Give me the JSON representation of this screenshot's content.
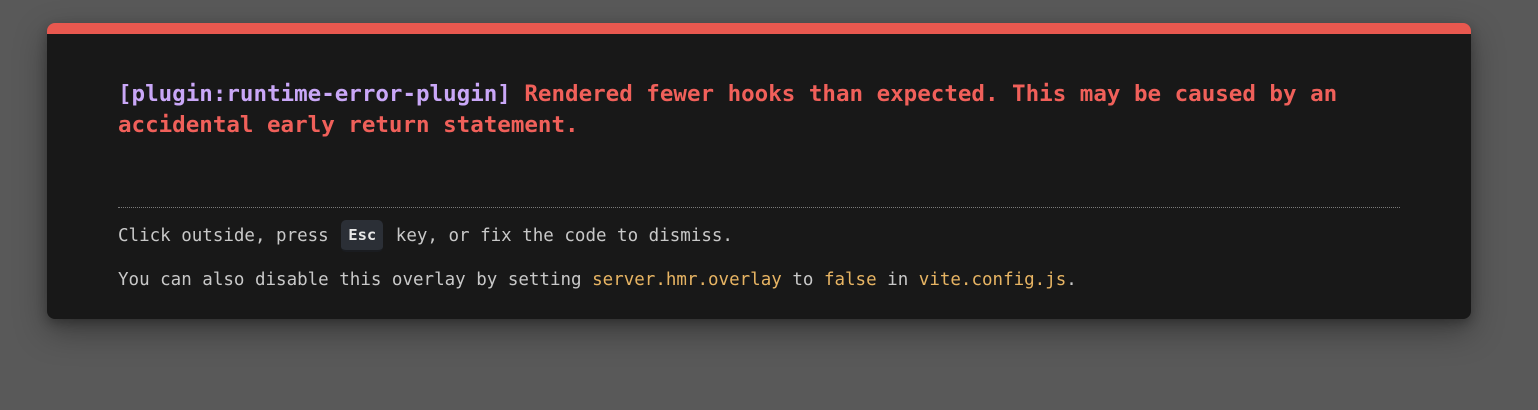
{
  "error": {
    "plugin": "[plugin:runtime-error-plugin]",
    "message": "Rendered fewer hooks than expected. This may be caused by an accidental early return statement."
  },
  "tip": {
    "line1_before": "Click outside, press ",
    "key": "Esc",
    "line1_after": " key, or fix the code to dismiss.",
    "line2_before": "You can also disable this overlay by setting ",
    "setting": "server.hmr.overlay",
    "line2_mid1": " to ",
    "value": "false",
    "line2_mid2": " in ",
    "file": "vite.config.js",
    "line2_end": "."
  },
  "colors": {
    "accent_bar": "#e8584f",
    "plugin_text": "#c9a7f7",
    "error_text": "#f0605a",
    "code_text": "#e7b463",
    "panel_bg": "#181818",
    "backdrop": "#595959"
  }
}
